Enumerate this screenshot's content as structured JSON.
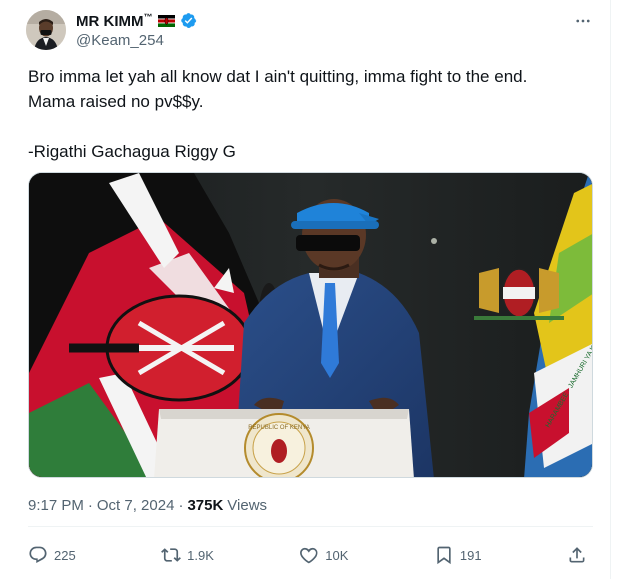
{
  "author": {
    "display_name": "MR KIMM",
    "trademark": "™",
    "handle": "@Keam_254",
    "verified": true
  },
  "tweet": {
    "text_line1": "Bro imma let yah all know dat I ain't quitting, imma fight to the end.",
    "text_line2": "Mama raised no pv$$y.",
    "text_line3": "-Rigathi Gachagua Riggy G"
  },
  "media": {
    "podium_seal_text": "REPUBLIC OF KENYA",
    "right_flag_text": "HARAMBEE · JAMHURI YA KENYA · IDEGEKI Y'AFRIKA"
  },
  "meta": {
    "time": "9:17 PM",
    "separator1": "·",
    "date": "Oct 7, 2024",
    "separator2": "·",
    "views": "375K",
    "views_label": "Views"
  },
  "actions": {
    "replies": "225",
    "reposts": "1.9K",
    "likes": "10K",
    "bookmarks": "191"
  },
  "colors": {
    "accent": "#1d9bf0",
    "secondary_text": "#536471",
    "primary_text": "#0f1419"
  }
}
